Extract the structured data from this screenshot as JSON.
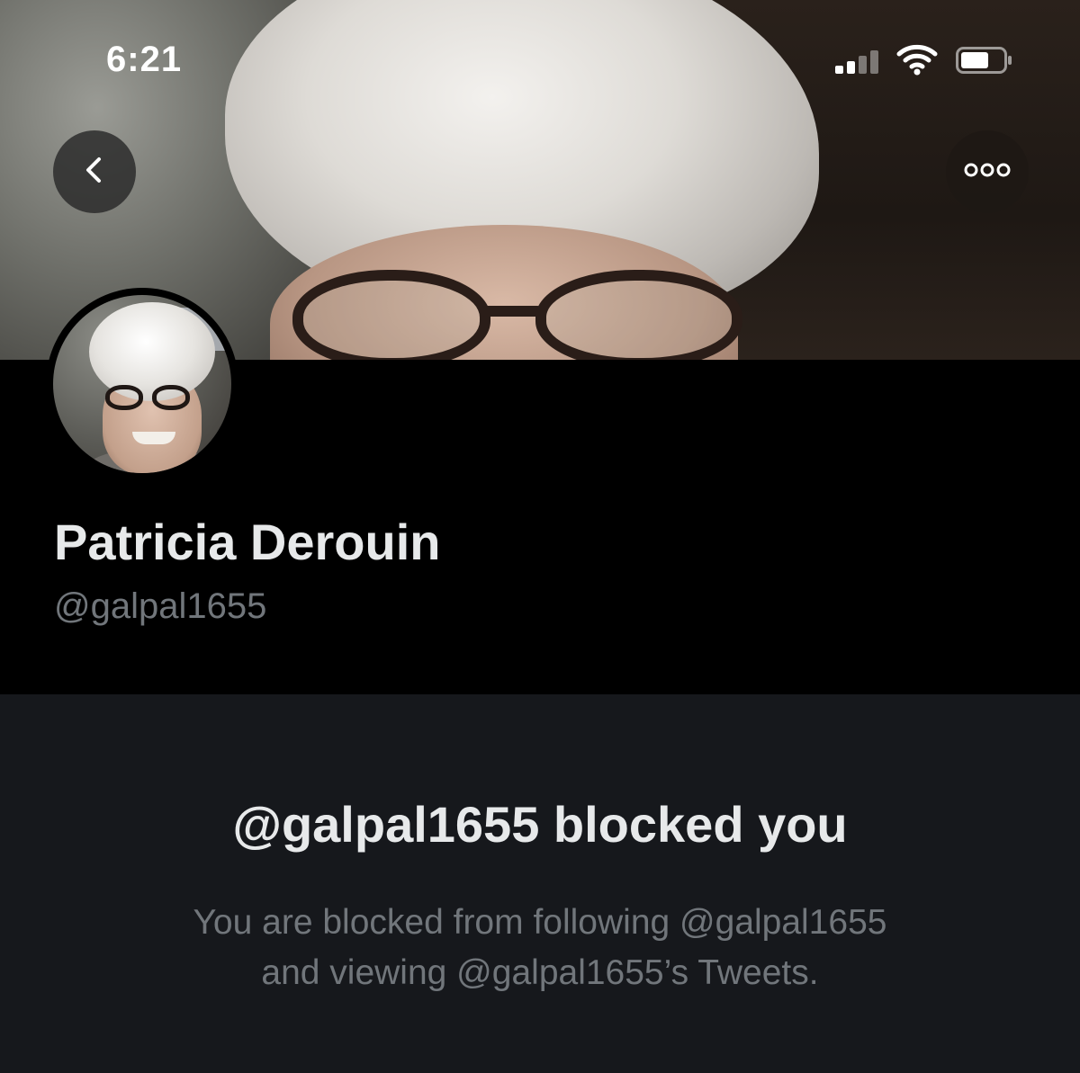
{
  "status_bar": {
    "time": "6:21"
  },
  "icons": {
    "back": "chevron-left-icon",
    "more": "more-horizontal-icon",
    "signal": "cellular-signal-icon",
    "wifi": "wifi-icon",
    "battery": "battery-icon"
  },
  "profile": {
    "display_name": "Patricia Derouin",
    "handle": "@galpal1655"
  },
  "blocked_notice": {
    "title": "@galpal1655 blocked you",
    "description_line1": "You are blocked from following @galpal1655",
    "description_line2": "and viewing @galpal1655’s Tweets."
  },
  "colors": {
    "background": "#000000",
    "panel": "#16181c",
    "primary_text": "#e7e9ea",
    "secondary_text": "#71767b"
  }
}
